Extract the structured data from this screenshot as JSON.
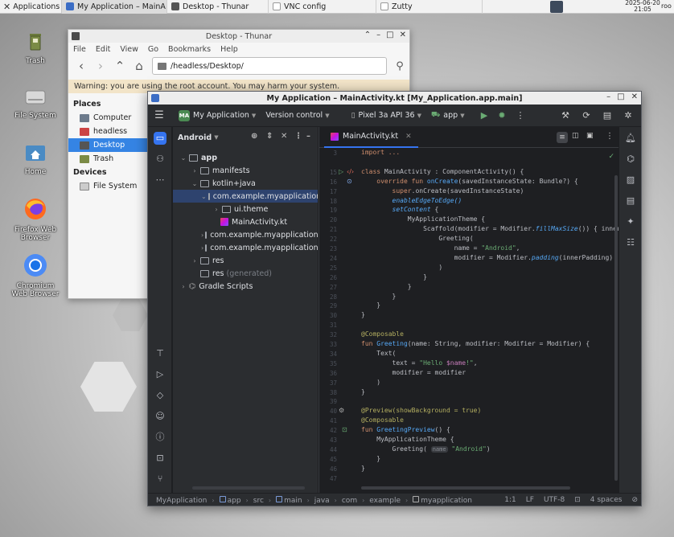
{
  "taskbar": {
    "start_label": "Applications",
    "tasks": [
      {
        "label": "My Application – MainA…",
        "active": true
      },
      {
        "label": "Desktop - Thunar",
        "active": false
      },
      {
        "label": "VNC config",
        "active": false
      },
      {
        "label": "Zutty",
        "active": false
      }
    ],
    "clock_date": "2025-06-20",
    "clock_time": "21:05",
    "user": "roo"
  },
  "desktop": {
    "icons": [
      "Trash",
      "File System",
      "Home",
      "Firefox Web Browser",
      "Chromium Web Browser"
    ]
  },
  "thunar": {
    "title": "Desktop - Thunar",
    "menu": [
      "File",
      "Edit",
      "View",
      "Go",
      "Bookmarks",
      "Help"
    ],
    "address": "/headless/Desktop/",
    "warning": "Warning: you are using the root account. You may harm your system.",
    "places_label": "Places",
    "places": [
      "Computer",
      "headless",
      "Desktop",
      "Trash"
    ],
    "selected_place": "Desktop",
    "devices_label": "Devices",
    "devices": [
      "File System"
    ]
  },
  "studio": {
    "title": "My Application – MainActivity.kt [My_Application.app.main]",
    "project_badge": "MA",
    "project_name": "My Application",
    "vcs": "Version control",
    "device": "Pixel 3a API 36",
    "run_config": "app",
    "project_view": "Android",
    "tree": [
      {
        "label": "app",
        "extra": ""
      },
      {
        "label": "manifests",
        "extra": ""
      },
      {
        "label": "kotlin+java",
        "extra": ""
      },
      {
        "label": "com.example.myapplication",
        "extra": ""
      },
      {
        "label": "ui.theme",
        "extra": ""
      },
      {
        "label": "MainActivity.kt",
        "extra": ""
      },
      {
        "label": "com.example.myapplication",
        "extra": "("
      },
      {
        "label": "com.example.myapplication",
        "extra": "("
      },
      {
        "label": "res",
        "extra": ""
      },
      {
        "label": "res",
        "extra": "(generated)"
      },
      {
        "label": "Gradle Scripts",
        "extra": ""
      }
    ],
    "tab": "MainActivity.kt",
    "line_numbers": [
      "3",
      "15",
      "16",
      "17",
      "18",
      "19",
      "20",
      "21",
      "22",
      "23",
      "24",
      "25",
      "26",
      "27",
      "28",
      "29",
      "30",
      "31",
      "32",
      "33",
      "34",
      "35",
      "36",
      "37",
      "38",
      "39",
      "40",
      "41",
      "42",
      "43",
      "44",
      "45",
      "46",
      "47"
    ],
    "code": {
      "l3": "import ...",
      "l16_kw": "class ",
      "l16_rest": "MainActivity : ComponentActivity() {",
      "l17_kw": "override fun ",
      "l17_fn": "onCreate",
      "l17_rest": "(savedInstanceState: Bundle?) {",
      "l18_kw": "super",
      "l18_rest": ".onCreate(savedInstanceState)",
      "l19": "enableEdgeToEdge()",
      "l20_it": "setContent",
      "l20_rest": " {",
      "l21": "MyApplicationTheme {",
      "l22_a": "Scaffold(modifier = Modifier.",
      "l22_it": "fillMaxSize",
      "l22_b": "()) { innerPadd",
      "l23": "Greeting(",
      "l24_a": "name = ",
      "l24_st": "\"Android\"",
      "l24_b": ",",
      "l25_a": "modifier = Modifier.",
      "l25_it": "padding",
      "l25_b": "(innerPadding)",
      "close_paren": ")",
      "close_brace": "}",
      "l33": "@Composable",
      "l34_kw": "fun ",
      "l34_fn": "Greeting",
      "l34_rest": "(name: String, modifier: Modifier = Modifier) {",
      "l35": "Text(",
      "l36_a": "text = ",
      "l36_st": "\"Hello ",
      "l36_pm": "$name",
      "l36_st2": "!\"",
      "l36_b": ",",
      "l37": "modifier = modifier",
      "l41": "@Preview(showBackground = true)",
      "l42": "@Composable",
      "l43_kw": "fun ",
      "l43_fn": "GreetingPreview",
      "l43_rest": "() {",
      "l44": "MyApplicationTheme {",
      "l45_a": "Greeting(",
      "l45_hint": "name",
      "l45_st": "\"Android\"",
      "l45_b": ")"
    },
    "status": {
      "crumbs": [
        "MyApplication",
        "app",
        "src",
        "main",
        "java",
        "com",
        "example",
        "myapplication"
      ],
      "pos": "1:1",
      "eol": "LF",
      "enc": "UTF-8",
      "indent": "4 spaces"
    }
  }
}
